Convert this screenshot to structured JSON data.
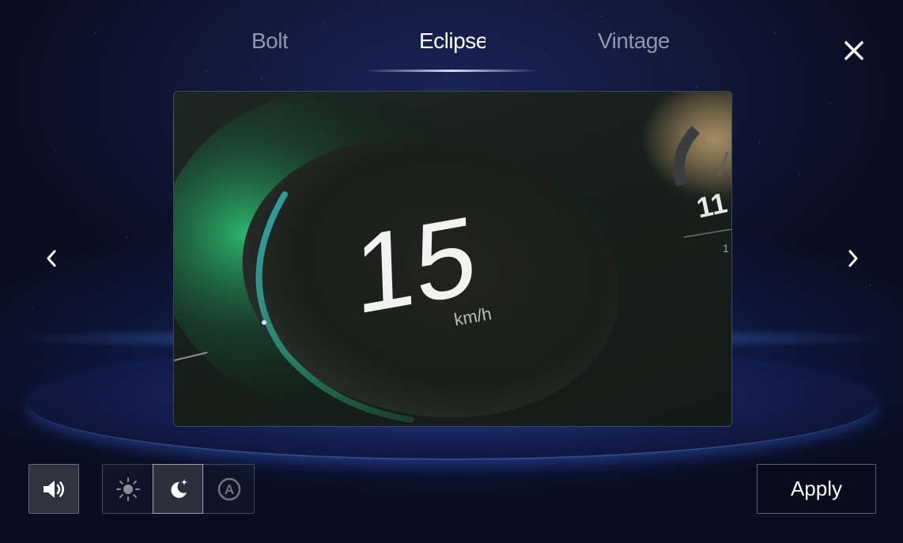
{
  "tabs": [
    {
      "label": "Bolt",
      "active": false
    },
    {
      "label": "Eclipse",
      "active": true
    },
    {
      "label": "Vintage",
      "active": false
    }
  ],
  "preview": {
    "speed_value": "15",
    "speed_unit": "km/h",
    "secondary_gauge_value": "11",
    "secondary_gauge_sub": "1"
  },
  "controls": {
    "apply_label": "Apply",
    "sound_icon": "speaker-icon",
    "modes": [
      {
        "icon": "sun-icon",
        "active": false
      },
      {
        "icon": "moon-icon",
        "active": true
      },
      {
        "icon": "auto-icon",
        "active": false,
        "glyph": "A"
      }
    ]
  },
  "icons": {
    "close": "close-icon",
    "prev": "chevron-left-icon",
    "next": "chevron-right-icon"
  },
  "colors": {
    "accent_green": "#2fd07a",
    "accent_teal": "#37b9c2",
    "active_tab": "#ffffff",
    "inactive_tab": "#8f97ad"
  }
}
